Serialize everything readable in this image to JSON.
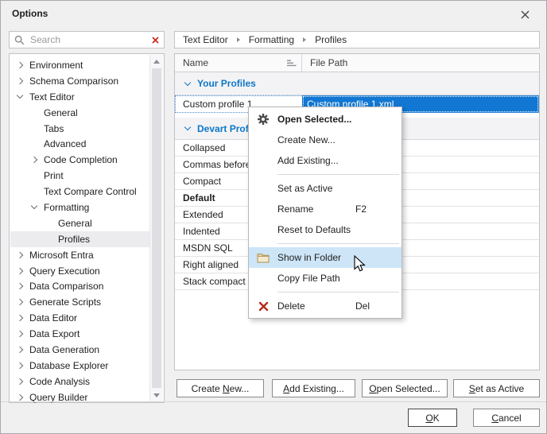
{
  "window": {
    "title": "Options"
  },
  "search": {
    "placeholder": "Search"
  },
  "breadcrumb": {
    "items": [
      "Text Editor",
      "Formatting",
      "Profiles"
    ]
  },
  "tree": {
    "items": [
      {
        "label": "Environment",
        "level": 0,
        "state": "collapsed"
      },
      {
        "label": "Schema Comparison",
        "level": 0,
        "state": "collapsed"
      },
      {
        "label": "Text Editor",
        "level": 0,
        "state": "expanded"
      },
      {
        "label": "General",
        "level": 1,
        "state": "leaf"
      },
      {
        "label": "Tabs",
        "level": 1,
        "state": "leaf"
      },
      {
        "label": "Advanced",
        "level": 1,
        "state": "leaf"
      },
      {
        "label": "Code Completion",
        "level": 1,
        "state": "collapsed"
      },
      {
        "label": "Print",
        "level": 1,
        "state": "leaf"
      },
      {
        "label": "Text Compare Control",
        "level": 1,
        "state": "leaf"
      },
      {
        "label": "Formatting",
        "level": 1,
        "state": "expanded"
      },
      {
        "label": "General",
        "level": 2,
        "state": "leaf"
      },
      {
        "label": "Profiles",
        "level": 2,
        "state": "leaf",
        "selected": true
      },
      {
        "label": "Microsoft Entra",
        "level": 0,
        "state": "collapsed"
      },
      {
        "label": "Query Execution",
        "level": 0,
        "state": "collapsed"
      },
      {
        "label": "Data Comparison",
        "level": 0,
        "state": "collapsed"
      },
      {
        "label": "Generate Scripts",
        "level": 0,
        "state": "collapsed"
      },
      {
        "label": "Data Editor",
        "level": 0,
        "state": "collapsed"
      },
      {
        "label": "Data Export",
        "level": 0,
        "state": "collapsed"
      },
      {
        "label": "Data Generation",
        "level": 0,
        "state": "collapsed"
      },
      {
        "label": "Database Explorer",
        "level": 0,
        "state": "collapsed"
      },
      {
        "label": "Code Analysis",
        "level": 0,
        "state": "collapsed"
      },
      {
        "label": "Query Builder",
        "level": 0,
        "state": "collapsed"
      }
    ]
  },
  "table": {
    "columns": [
      {
        "label": "Name",
        "sorted": true
      },
      {
        "label": "File Path"
      }
    ],
    "groups": [
      {
        "label": "Your Profiles",
        "rows": [
          {
            "name": "Custom profile 1",
            "file_path": "Custom profile 1.xml",
            "selected": true
          }
        ]
      },
      {
        "label": "Devart Profiles",
        "rows": [
          {
            "name": "Collapsed",
            "file_path": ""
          },
          {
            "name": "Commas before",
            "file_path": ""
          },
          {
            "name": "Compact",
            "file_path": ""
          },
          {
            "name": "Default",
            "file_path": "",
            "bold": true
          },
          {
            "name": "Extended",
            "file_path": ""
          },
          {
            "name": "Indented",
            "file_path": ""
          },
          {
            "name": "MSDN SQL",
            "file_path": ""
          },
          {
            "name": "Right aligned",
            "file_path": ""
          },
          {
            "name": "Stack compact",
            "file_path": ""
          }
        ]
      }
    ]
  },
  "context_menu": {
    "items": [
      {
        "label": "Open Selected...",
        "icon": "gear-icon",
        "bold": true
      },
      {
        "label": "Create New..."
      },
      {
        "label": "Add Existing..."
      },
      {
        "separator": true
      },
      {
        "label": "Set as Active"
      },
      {
        "label": "Rename",
        "shortcut": "F2"
      },
      {
        "label": "Reset to Defaults"
      },
      {
        "separator": true
      },
      {
        "label": "Show in Folder",
        "icon": "folder-icon",
        "highlighted": true
      },
      {
        "label": "Copy File Path"
      },
      {
        "separator": true
      },
      {
        "label": "Delete",
        "icon": "delete-icon",
        "shortcut": "Del"
      }
    ]
  },
  "action_buttons": [
    {
      "pre": "Create ",
      "key": "N",
      "post": "ew..."
    },
    {
      "pre": "",
      "key": "A",
      "post": "dd Existing..."
    },
    {
      "pre": "",
      "key": "O",
      "post": "pen Selected..."
    },
    {
      "pre": "",
      "key": "S",
      "post": "et as Active"
    }
  ],
  "dialog_buttons": {
    "ok": {
      "pre": "",
      "key": "O",
      "post": "K"
    },
    "cancel": {
      "pre": "",
      "key": "C",
      "post": "ancel"
    }
  },
  "colors": {
    "selection_blue": "#1177d2",
    "group_header_blue": "#0d77c8",
    "menu_highlight": "#cde5f7",
    "delete_red": "#b42b1e",
    "clear_red": "#c9271e"
  }
}
